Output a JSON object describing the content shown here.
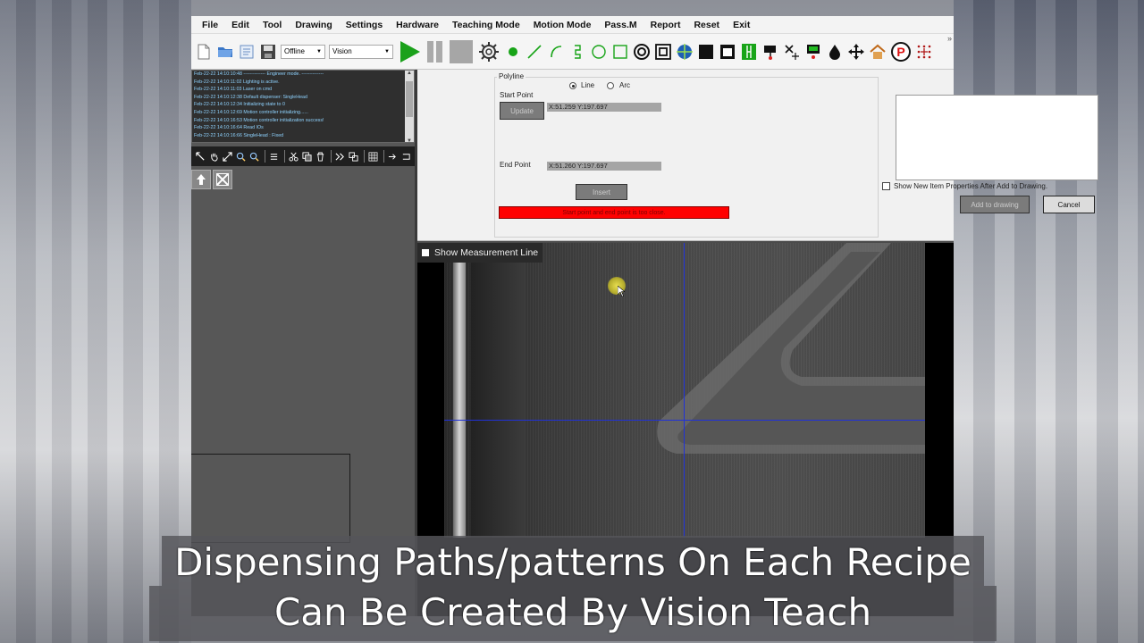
{
  "menu": [
    "File",
    "Edit",
    "Tool",
    "Drawing",
    "Settings",
    "Hardware",
    "Teaching Mode",
    "Motion Mode",
    "Pass.M",
    "Report",
    "Reset",
    "Exit"
  ],
  "toolbar": {
    "mode_select": "Offline",
    "view_select": "Vision",
    "overflow": "»"
  },
  "log": [
    "Feb-22-22  14:10:10:48   -------------- Engineer mode. --------------",
    "Feb-22-22  14:10:11:02   Lighting is active.",
    "Feb-22-22  14:10:11:03   Laser on cmd",
    "Feb-22-22  14:10:12:38   Default dispenser: SingleHead",
    "Feb-22-22  14:10:12:34   Initializing state to 0",
    "Feb-22-22  14:10:12:69   Motion controller initializing......",
    "Feb-22-22  14:10:16:53   Motion controller initialization success!",
    "Feb-22-22  14:10:16:64   Read IOs",
    "Feb-22-22  14:10:16:66   SingleHead : Fixed"
  ],
  "polyline": {
    "group_title": "Polyline",
    "line_label": "Line",
    "arc_label": "Arc",
    "start_label": "Start Point",
    "update_label": "Update",
    "start_coord": "X:51.259 Y:197.697",
    "end_label": "End Point",
    "end_coord": "X:51.260 Y:197.697",
    "insert_label": "Insert",
    "error_text": "Start point and end point is too close.",
    "show_props_label": "Show New Item Properties After Add to Drawing.",
    "add_label": "Add to drawing",
    "cancel_label": "Cancel"
  },
  "vision": {
    "measure_label": "Show Measurement Line"
  },
  "caption": {
    "line1": "Dispensing Paths/patterns On Each Recipe",
    "line2": "Can Be Created By Vision Teach"
  },
  "colors": {
    "play": "#1aa11a",
    "crosshair": "#2031d8",
    "error": "#ff0000",
    "cursor": "#e8dc3a"
  }
}
